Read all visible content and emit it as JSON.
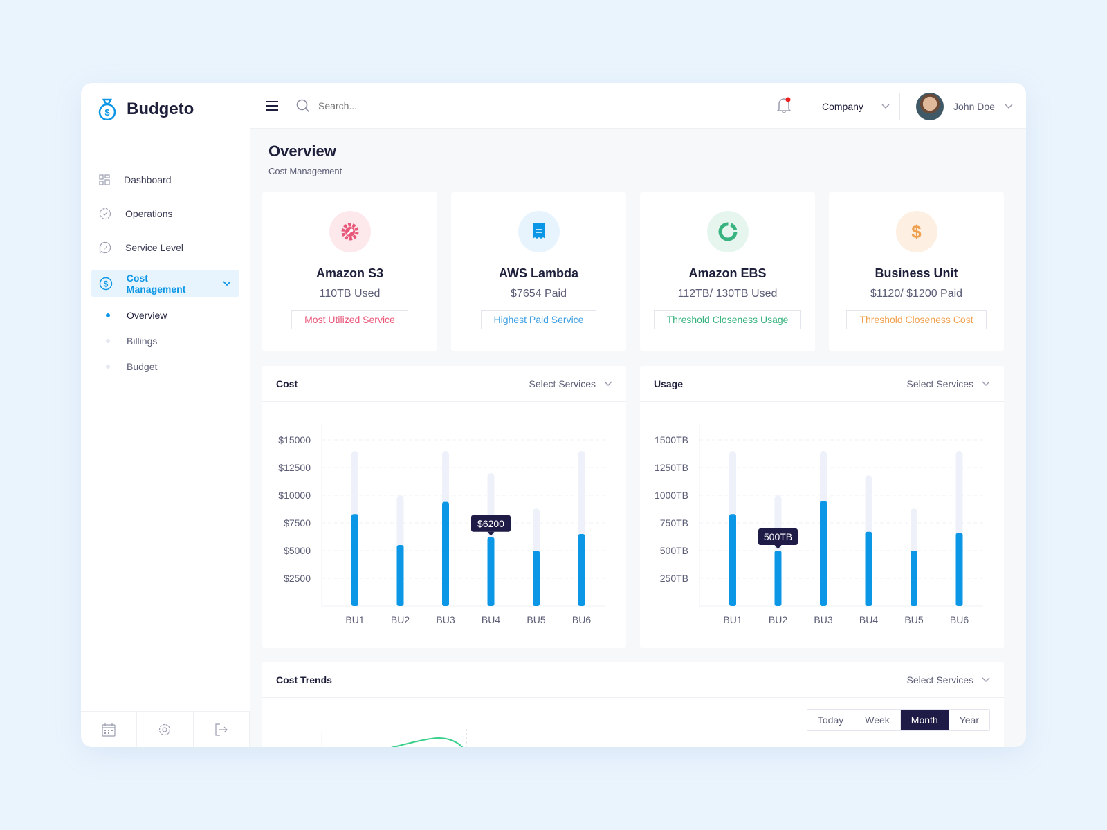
{
  "brand": {
    "name": "Budgeto",
    "accent": "#0b97e6"
  },
  "sidebar": {
    "items": [
      {
        "label": "Dashboard",
        "icon": "grid-icon"
      },
      {
        "label": "Operations",
        "icon": "badge-check-icon"
      },
      {
        "label": "Service Level",
        "icon": "question-bubble-icon"
      },
      {
        "label": "Cost Management",
        "icon": "dollar-circle-icon",
        "active": true
      }
    ],
    "sub_items": [
      {
        "label": "Overview",
        "active": true
      },
      {
        "label": "Billings"
      },
      {
        "label": "Budget"
      }
    ],
    "footer_icons": [
      "calendar-icon",
      "gear-icon",
      "logout-icon"
    ]
  },
  "header": {
    "search_placeholder": "Search...",
    "company": "Company",
    "user": "John Doe",
    "notification": true
  },
  "page": {
    "title": "Overview",
    "subtitle": "Cost Management"
  },
  "stats": [
    {
      "name": "Amazon S3",
      "value": "110TB Used",
      "tag": "Most Utilized Service",
      "color": "#e8587a",
      "bg": "#fde8ec",
      "icon": "gear-wrench-icon"
    },
    {
      "name": "AWS Lambda",
      "value": "$7654 Paid",
      "tag": "Highest Paid Service",
      "color": "#3d9fe3",
      "bg": "#e8f4fd",
      "icon": "receipt-icon"
    },
    {
      "name": "Amazon EBS",
      "value": "112TB/ 130TB Used",
      "tag": "Threshold Closeness Usage",
      "color": "#38b27e",
      "bg": "#e6f6ef",
      "icon": "ring-icon"
    },
    {
      "name": "Business Unit",
      "value": "$1120/ $1200 Paid",
      "tag": "Threshold Closeness Cost",
      "color": "#f0a150",
      "bg": "#fdf0e2",
      "icon": "dollar-icon"
    }
  ],
  "chart_data": [
    {
      "type": "bar",
      "title": "Cost",
      "select": "Select Services",
      "categories": [
        "BU1",
        "BU2",
        "BU3",
        "BU4",
        "BU5",
        "BU6"
      ],
      "values": [
        8300,
        5500,
        9400,
        6200,
        5000,
        6500
      ],
      "max_values": [
        14000,
        10000,
        14000,
        12000,
        8800,
        14000
      ],
      "yticks": [
        "$2500",
        "$5000",
        "$7500",
        "$10000",
        "$12500",
        "$15000"
      ],
      "ylim": [
        0,
        15000
      ],
      "tooltip": "$6200",
      "tooltip_index": 3,
      "grid": true
    },
    {
      "type": "bar",
      "title": "Usage",
      "select": "Select Services",
      "categories": [
        "BU1",
        "BU2",
        "BU3",
        "BU4",
        "BU5",
        "BU6"
      ],
      "values": [
        830,
        500,
        950,
        670,
        500,
        660
      ],
      "max_values": [
        1400,
        1000,
        1400,
        1180,
        880,
        1400
      ],
      "yticks": [
        "250TB",
        "500TB",
        "750TB",
        "1000TB",
        "1250TB",
        "1500TB"
      ],
      "ylim": [
        0,
        1500
      ],
      "tooltip": "500TB",
      "tooltip_index": 1,
      "grid": true
    }
  ],
  "trends": {
    "title": "Cost Trends",
    "select": "Select Services",
    "ranges": [
      "Today",
      "Week",
      "Month",
      "Year"
    ],
    "active": "Month"
  }
}
